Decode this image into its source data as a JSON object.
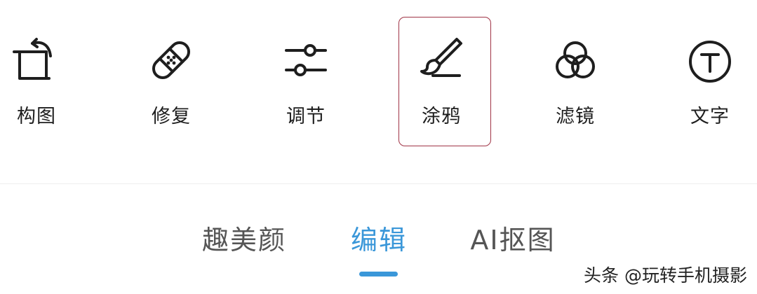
{
  "tools": [
    {
      "label": "构图",
      "icon": "crop-rotate-icon"
    },
    {
      "label": "修复",
      "icon": "bandage-icon"
    },
    {
      "label": "调节",
      "icon": "sliders-icon"
    },
    {
      "label": "涂鸦",
      "icon": "paintbrush-icon",
      "highlighted": true
    },
    {
      "label": "滤镜",
      "icon": "filter-circles-icon"
    },
    {
      "label": "文字",
      "icon": "text-circle-icon"
    }
  ],
  "tabs": [
    {
      "label": "趣美颜",
      "active": false
    },
    {
      "label": "编辑",
      "active": true
    },
    {
      "label": "AI抠图",
      "active": false
    }
  ],
  "watermark": "头条 @玩转手机摄影",
  "colors": {
    "accent": "#3a97d9",
    "highlight_border": "#a03446",
    "icon_stroke": "#1e1e1e",
    "inactive_tab": "#555555"
  }
}
